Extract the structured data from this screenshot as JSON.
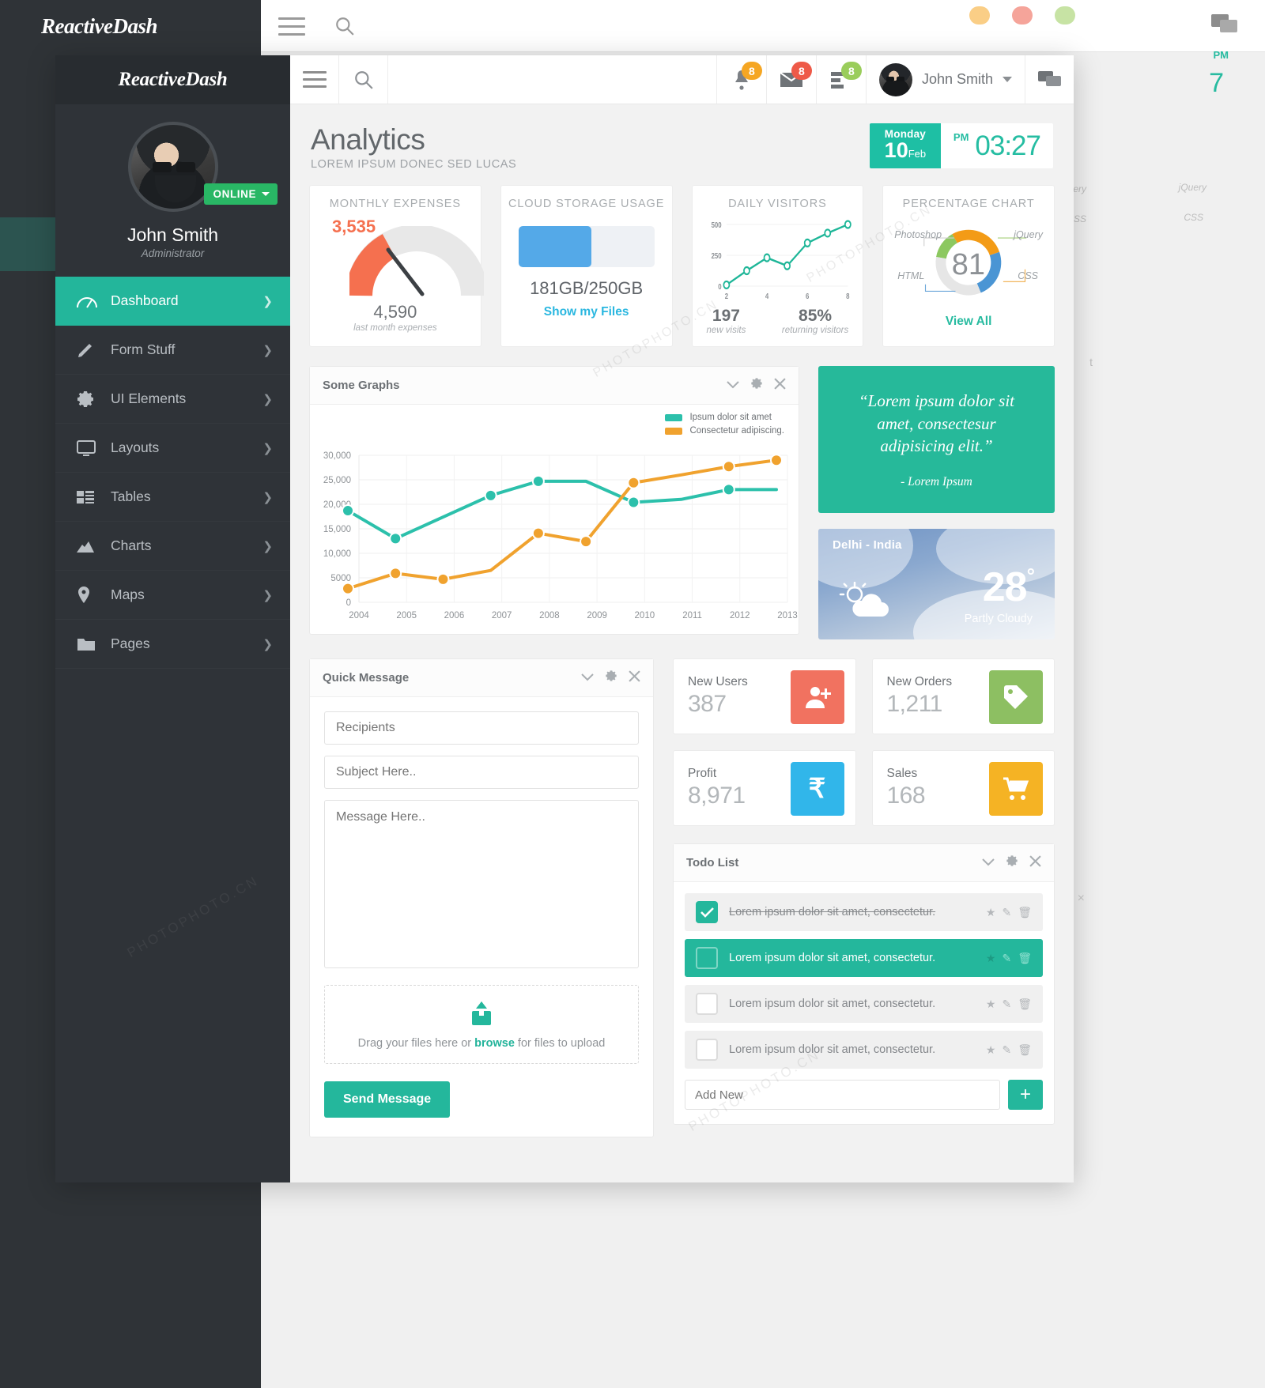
{
  "brand": "ReactiveDash",
  "sidebar": {
    "profile": {
      "name": "John Smith",
      "role": "Administrator",
      "status": "ONLINE"
    },
    "items": [
      {
        "label": "Dashboard",
        "icon": "speedometer-icon",
        "active": true
      },
      {
        "label": "Form Stuff",
        "icon": "pencil-icon",
        "active": false
      },
      {
        "label": "UI Elements",
        "icon": "gear-icon",
        "active": false
      },
      {
        "label": "Layouts",
        "icon": "monitor-icon",
        "active": false
      },
      {
        "label": "Tables",
        "icon": "table-icon",
        "active": false
      },
      {
        "label": "Charts",
        "icon": "chart-icon",
        "active": false
      },
      {
        "label": "Maps",
        "icon": "map-pin-icon",
        "active": false
      },
      {
        "label": "Pages",
        "icon": "folder-icon",
        "active": false
      }
    ]
  },
  "topbar": {
    "search_placeholder": "",
    "notifications_badge": "8",
    "messages_badge": "8",
    "tasks_badge": "8",
    "username": "John Smith"
  },
  "page": {
    "title": "Analytics",
    "subtitle": "LOREM IPSUM DONEC SED LUCAS",
    "clock": {
      "dow": "Monday",
      "day": "10",
      "month": "Feb",
      "time": "03:27",
      "ampm": "PM"
    }
  },
  "cards": {
    "expenses": {
      "title": "MONTHLY EXPENSES",
      "value": "3,535",
      "foot_value": "4,590",
      "foot_label": "last month expenses",
      "gauge_percent": 40,
      "color": "#f5704f"
    },
    "storage": {
      "title": "CLOUD STORAGE USAGE",
      "used_text": "181GB/250GB",
      "percent": 54,
      "link": "Show my Files",
      "color": "#54a9e8"
    },
    "visitors": {
      "title": "DAILY VISITORS",
      "new_value": "197",
      "new_label": "new visits",
      "returning_value": "85%",
      "returning_label": "returning visitors"
    },
    "percentage": {
      "title": "PERCENTAGE CHART",
      "center": "81",
      "link": "View All",
      "labels": [
        "Photoshop",
        "jQuery",
        "HTML",
        "CSS"
      ]
    }
  },
  "chart_data": [
    {
      "type": "line",
      "title": "Some Graphs",
      "x": [
        2004,
        2005,
        2006,
        2007,
        2008,
        2009,
        2010,
        2011,
        2012,
        2013
      ],
      "xlabel": "",
      "ylabel": "",
      "ylim": [
        0,
        30000
      ],
      "yticks": [
        0,
        5000,
        10000,
        15000,
        20000,
        25000,
        30000
      ],
      "ytick_labels": [
        "0",
        "5000",
        "10,000",
        "15,000",
        "20,000",
        "25,000",
        "30,000"
      ],
      "grid": true,
      "legend_position": "top-right",
      "series": [
        {
          "name": "Ipsum dolor sit amet",
          "color": "#2cc0ab",
          "values": [
            18700,
            13000,
            null,
            21800,
            24700,
            24700,
            20400,
            21000,
            23000,
            23000
          ]
        },
        {
          "name": "Consectetur adipiscing.",
          "color": "#f0a22e",
          "values": [
            2800,
            5900,
            4700,
            6500,
            14100,
            12400,
            24400,
            26000,
            27700,
            29000
          ]
        }
      ],
      "series_teal_plotted": [
        18700,
        13000,
        21800,
        24700,
        20400,
        23000
      ],
      "series_orange_plotted": [
        2800,
        5900,
        4700,
        14100,
        12400,
        24400,
        27700,
        29000
      ]
    },
    {
      "type": "line",
      "title": "DAILY VISITORS",
      "x": [
        2,
        3,
        4,
        5,
        6,
        7,
        8
      ],
      "ylim": [
        0,
        500
      ],
      "yticks": [
        0,
        250,
        500
      ],
      "ytick_labels": [
        "0",
        "250",
        "500"
      ],
      "xticks": [
        2,
        4,
        6,
        8
      ],
      "xtick_labels": [
        "2",
        "4",
        "6",
        "8"
      ],
      "grid": true,
      "series": [
        {
          "name": "visitors",
          "color": "#1eb698",
          "values": [
            10,
            125,
            230,
            165,
            350,
            430,
            500
          ]
        }
      ]
    },
    {
      "type": "pie",
      "title": "PERCENTAGE CHART",
      "center_label": "81",
      "labels": [
        "jQuery",
        "CSS",
        "HTML",
        "Photoshop"
      ],
      "values": [
        14,
        28,
        24,
        34
      ],
      "colors": [
        "#8cc860",
        "#f39b16",
        "#4a95d4",
        "#e6e6e6"
      ]
    },
    {
      "type": "gauge",
      "title": "MONTHLY EXPENSES",
      "value": 3535,
      "percent": 40,
      "color": "#f5704f",
      "track_color": "#e8e8e8"
    }
  ],
  "graph_panel": {
    "title": "Some Graphs",
    "legend": [
      "Ipsum dolor sit amet",
      "Consectetur adipiscing."
    ]
  },
  "quote": {
    "text": "“Lorem ipsum dolor sit amet, consectesur adipisicing elit.”",
    "author": "- Lorem Ipsum",
    "color": "#26b99a"
  },
  "weather": {
    "city": "Delhi - India",
    "temp": "28",
    "unit": "°",
    "desc": "Partly Cloudy"
  },
  "quick_message": {
    "title": "Quick Message",
    "recipients_placeholder": "Recipients",
    "subject_placeholder": "Subject Here..",
    "message_placeholder": "Message Here..",
    "drop_prefix": "Drag your files here or ",
    "drop_link": "browse",
    "drop_suffix": " for files to upload",
    "send_label": "Send Message"
  },
  "stats": [
    {
      "label": "New Users",
      "value": "387",
      "icon": "user-plus-icon",
      "color": "#f17260"
    },
    {
      "label": "New Orders",
      "value": "1,211",
      "icon": "tag-icon",
      "color": "#8dbf62"
    },
    {
      "label": "Profit",
      "value": "8,971",
      "icon": "rupee-icon",
      "color": "#31b6ea"
    },
    {
      "label": "Sales",
      "value": "168",
      "icon": "cart-icon",
      "color": "#f5b324"
    }
  ],
  "todo": {
    "title": "Todo List",
    "items": [
      {
        "text": "Lorem ipsum dolor sit amet, consectetur.",
        "state": "done"
      },
      {
        "text": "Lorem ipsum dolor sit amet, consectetur.",
        "state": "active"
      },
      {
        "text": "Lorem ipsum dolor sit amet, consectetur.",
        "state": "open"
      },
      {
        "text": "Lorem ipsum dolor sit amet, consectetur.",
        "state": "open"
      }
    ],
    "add_placeholder": "Add New",
    "add_label": "+"
  },
  "watermark": "PHOTOPHOTO.CN"
}
